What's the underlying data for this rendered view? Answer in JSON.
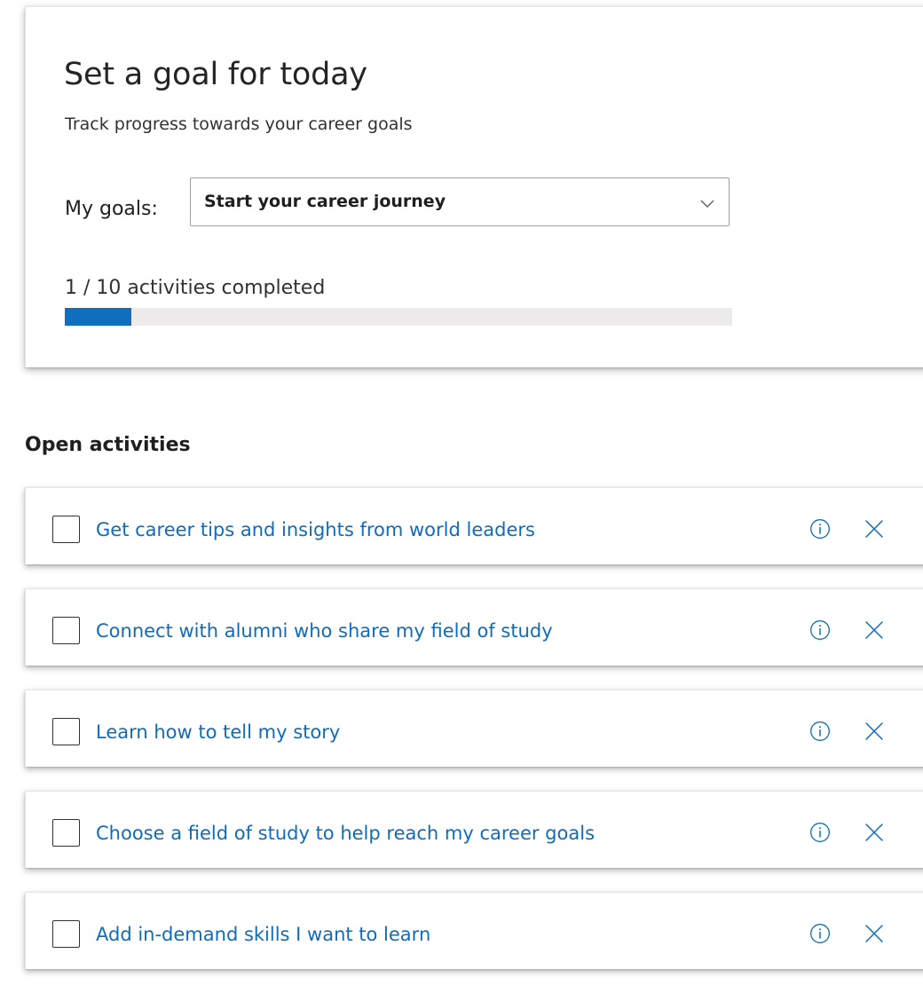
{
  "goal_card": {
    "title": "Set a goal for today",
    "subtitle": "Track progress towards your career goals",
    "goals_label": "My goals:",
    "selected_goal": "Start your career journey",
    "progress_text": "1 / 10 activities completed",
    "progress_completed": 1,
    "progress_total": 10,
    "progress_color": "#106ebe"
  },
  "open_activities": {
    "heading": "Open activities",
    "items": [
      {
        "label": "Get career tips and insights from world leaders",
        "checked": false,
        "info_icon": "info-icon",
        "dismiss_icon": "close-icon"
      },
      {
        "label": "Connect with alumni who share my field of study",
        "checked": false,
        "info_icon": "info-icon",
        "dismiss_icon": "close-icon"
      },
      {
        "label": "Learn how to tell my story",
        "checked": false,
        "info_icon": "info-icon",
        "dismiss_icon": "close-icon"
      },
      {
        "label": "Choose a field of study to help reach my career goals",
        "checked": false,
        "info_icon": "info-icon",
        "dismiss_icon": "close-icon"
      },
      {
        "label": "Add in-demand skills I want to learn",
        "checked": false,
        "info_icon": "info-icon",
        "dismiss_icon": "close-icon"
      }
    ]
  },
  "colors": {
    "link": "#0f6cbd",
    "accent": "#106ebe",
    "track": "#edebe9"
  }
}
